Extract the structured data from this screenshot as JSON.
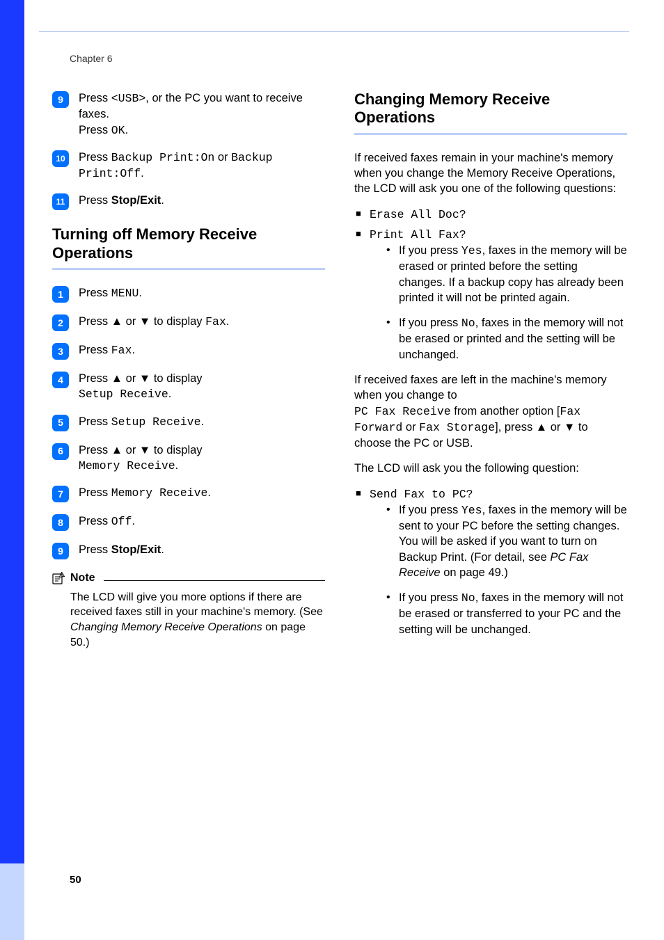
{
  "header": {
    "chapter": "Chapter 6"
  },
  "footer": {
    "page": "50"
  },
  "left": {
    "prev_steps": [
      {
        "num": "9",
        "t1": "Press ",
        "c1": "<USB>",
        "t2": ", or the PC you want to receive faxes.",
        "t3": "Press ",
        "c2": "OK",
        "t4": "."
      },
      {
        "num": "10",
        "t1": "Press ",
        "c1": "Backup Print:On",
        "t2": " or ",
        "c2": "Backup Print:Off",
        "t3": "."
      },
      {
        "num": "11",
        "t1": "Press ",
        "b1": "Stop/Exit",
        "t2": "."
      }
    ],
    "section1": {
      "title": "Turning off Memory Receive Operations",
      "steps": [
        {
          "num": "1",
          "t1": "Press ",
          "c1": "MENU",
          "t2": "."
        },
        {
          "num": "2",
          "t1": "Press ▲ or ▼ to display ",
          "c1": "Fax",
          "t2": "."
        },
        {
          "num": "3",
          "t1": "Press ",
          "c1": "Fax",
          "t2": "."
        },
        {
          "num": "4",
          "t1": "Press ▲ or ▼ to display",
          "c1": "Setup Receive",
          "t2": "."
        },
        {
          "num": "5",
          "t1": "Press ",
          "c1": "Setup Receive",
          "t2": "."
        },
        {
          "num": "6",
          "t1": "Press ▲ or ▼ to display",
          "c1": "Memory Receive",
          "t2": "."
        },
        {
          "num": "7",
          "t1": "Press ",
          "c1": "Memory Receive",
          "t2": "."
        },
        {
          "num": "8",
          "t1": "Press ",
          "c1": "Off",
          "t2": "."
        },
        {
          "num": "9",
          "t1": "Press ",
          "b1": "Stop/Exit",
          "t2": "."
        }
      ]
    },
    "note": {
      "label": "Note",
      "t1": "The LCD will give you more options if there are received faxes still in your machine's memory. (See ",
      "i1": "Changing Memory Receive Operations",
      "t2": " on page 50.)"
    }
  },
  "right": {
    "title": "Changing Memory Receive Operations",
    "p1": "If received faxes remain in your machine's memory when you change the Memory Receive Operations, the LCD will ask you one of the following questions:",
    "sq1": "Erase All Doc?",
    "sq2": "Print All Fax?",
    "b1": {
      "t1": "If you press ",
      "c1": "Yes",
      "t2": ", faxes in the memory will be erased or printed before the setting changes. If a backup copy has already been printed it will not be printed again."
    },
    "b2": {
      "t1": "If you press ",
      "c1": "No",
      "t2": ", faxes in the memory will not be erased or printed and the setting will be unchanged."
    },
    "p2": {
      "t1": "If received faxes are left in the machine's memory when you change to",
      "c1": "PC Fax Receive",
      "t2": " from another option ",
      "c2": "Fax Forward",
      "t3": " or ",
      "c3": "Fax Storage",
      "t4": ", press ▲ or ▼ to choose the PC or USB."
    },
    "p3": "The LCD will ask you the following question:",
    "sq3": "Send Fax to PC?",
    "b3": {
      "t1": "If you press ",
      "c1": "Yes",
      "t2": ", faxes in the memory will be sent to your PC before the setting changes. You will be asked if you want to turn on Backup Print. (For detail, see ",
      "i1": "PC Fax Receive",
      "t3": " on page 49.)"
    },
    "b4": {
      "t1": "If you press ",
      "c1": "No",
      "t2": ", faxes in the memory will not be erased or transferred to your PC and the setting will be unchanged."
    }
  }
}
